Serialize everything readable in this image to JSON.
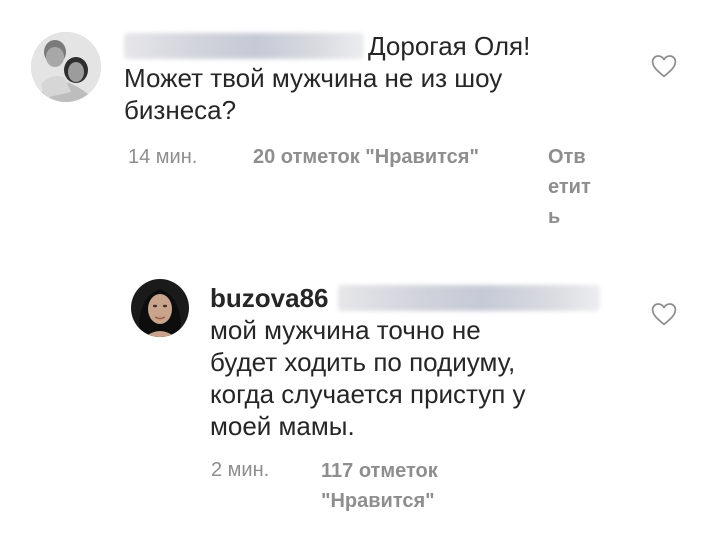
{
  "comments": [
    {
      "username": "",
      "mention_blurred": true,
      "text_line1": "Дорогая Оля!",
      "text_line2": "Может твой мужчина не из шоу",
      "text_line3": "бизнеса?",
      "time": "14 мин.",
      "likes": "20 отметок \"Нравится\"",
      "reply": "Ответить",
      "avatar": "couple-photo-avatar",
      "like_icon": "heart-outline-icon"
    },
    {
      "username": "buzova86",
      "mention_blurred": true,
      "text_line1": "мой мужчина точно не",
      "text_line2": "будет ходить по подиуму,",
      "text_line3": "когда случается приступ у",
      "text_line4": "моей мамы.",
      "time": "2 мин.",
      "likes_line1": "117 отметок",
      "likes_line2": "\"Нравится\"",
      "avatar": "woman-portrait-avatar",
      "like_icon": "heart-outline-icon"
    }
  ],
  "colors": {
    "text": "#262626",
    "meta": "#8e8e8e",
    "background": "#ffffff"
  }
}
